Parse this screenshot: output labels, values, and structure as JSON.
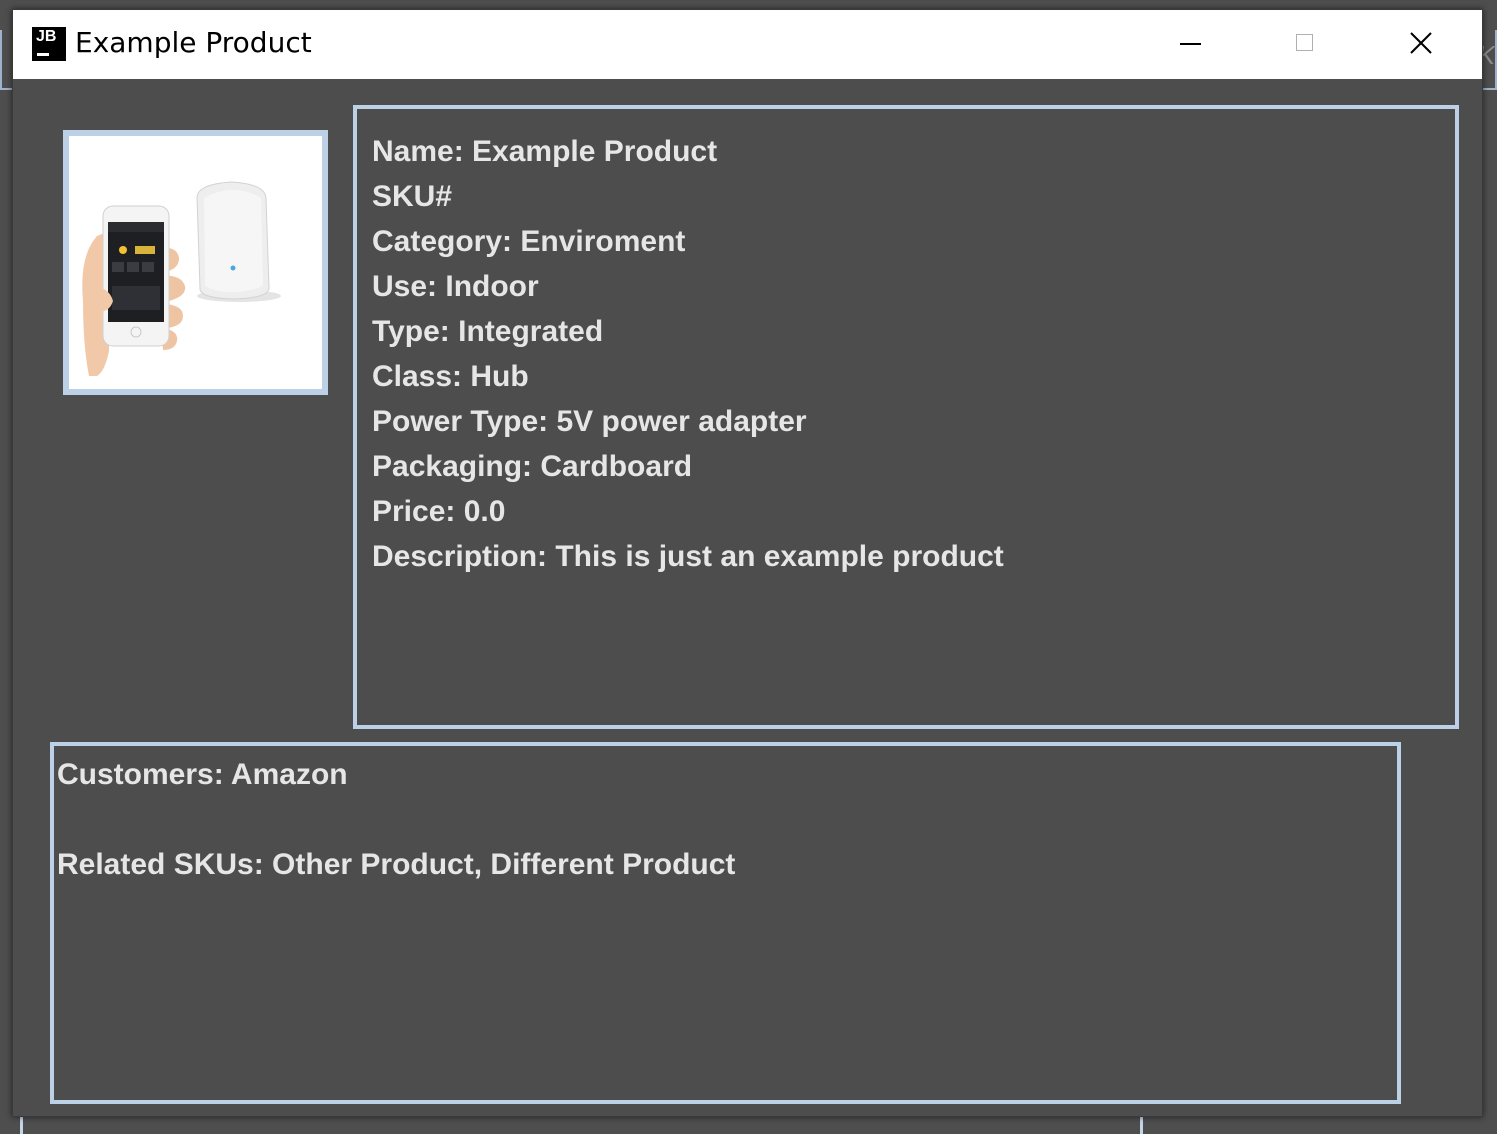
{
  "window": {
    "title": "Example Product",
    "icon_label": "JB",
    "icon": "jetbrains-app-icon",
    "controls": {
      "minimize": "minimize-icon",
      "maximize": "maximize-icon",
      "close": "close-icon"
    }
  },
  "background": {
    "partial_glyph": "K"
  },
  "product": {
    "image": "product-photo-smartphone-and-hub",
    "details": [
      "Name: Example Product",
      "SKU#",
      "Category: Enviroment",
      "Use: Indoor",
      "Type: Integrated",
      "Class: Hub",
      "Power Type: 5V power adapter",
      "Packaging: Cardboard",
      "Price: 0.0",
      "Description: This is just an example product"
    ]
  },
  "relations": {
    "customers": "Customers: Amazon",
    "related_skus": "Related SKUs: Other Product, Different Product"
  },
  "colors": {
    "panel_background": "#4d4d4d",
    "border": "#bcd0e6",
    "text": "#e6e6e6",
    "titlebar": "#ffffff"
  }
}
